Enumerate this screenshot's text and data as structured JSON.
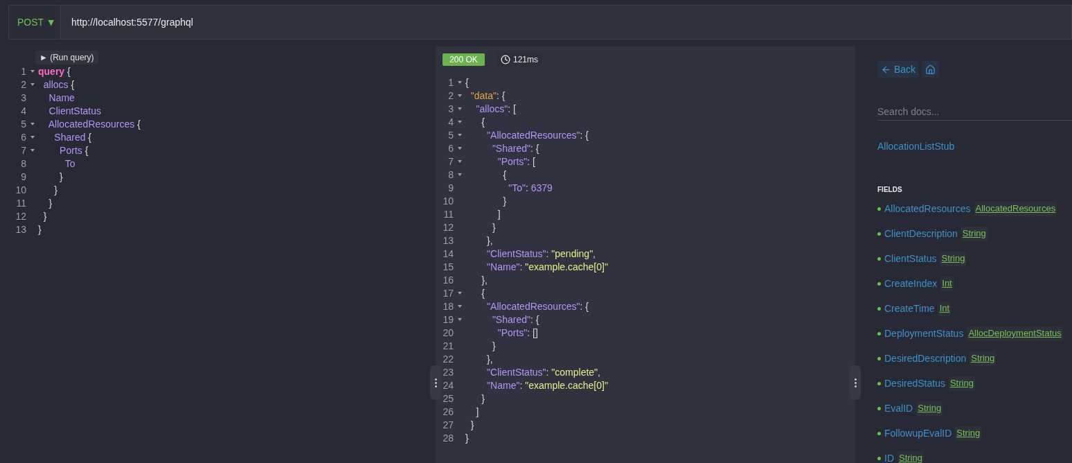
{
  "request": {
    "method": "POST ▼",
    "url": "http://localhost:5577/graphql"
  },
  "run_button": {
    "label": "► (Run query)"
  },
  "query_editor": {
    "lines": [
      {
        "number": "1",
        "foldable": true,
        "tokens": [
          {
            "kind": "keyword",
            "text": "query"
          },
          {
            "kind": "punct",
            "text": " {"
          }
        ]
      },
      {
        "number": "2",
        "foldable": true,
        "tokens": [
          {
            "kind": "field",
            "text": "  allocs"
          },
          {
            "kind": "punct",
            "text": " {"
          }
        ]
      },
      {
        "number": "3",
        "foldable": false,
        "tokens": [
          {
            "kind": "field",
            "text": "    Name"
          }
        ]
      },
      {
        "number": "4",
        "foldable": false,
        "tokens": [
          {
            "kind": "field",
            "text": "    ClientStatus"
          }
        ]
      },
      {
        "number": "5",
        "foldable": true,
        "tokens": [
          {
            "kind": "field",
            "text": "    AllocatedResources"
          },
          {
            "kind": "punct",
            "text": " {"
          }
        ]
      },
      {
        "number": "6",
        "foldable": true,
        "tokens": [
          {
            "kind": "field",
            "text": "      Shared"
          },
          {
            "kind": "punct",
            "text": " {"
          }
        ]
      },
      {
        "number": "7",
        "foldable": true,
        "tokens": [
          {
            "kind": "field",
            "text": "        Ports"
          },
          {
            "kind": "punct",
            "text": " {"
          }
        ]
      },
      {
        "number": "8",
        "foldable": false,
        "tokens": [
          {
            "kind": "field",
            "text": "          To"
          }
        ]
      },
      {
        "number": "9",
        "foldable": false,
        "tokens": [
          {
            "kind": "punct",
            "text": "        }"
          }
        ]
      },
      {
        "number": "10",
        "foldable": false,
        "tokens": [
          {
            "kind": "punct",
            "text": "      }"
          }
        ]
      },
      {
        "number": "11",
        "foldable": false,
        "tokens": [
          {
            "kind": "punct",
            "text": "    }"
          }
        ]
      },
      {
        "number": "12",
        "foldable": false,
        "tokens": [
          {
            "kind": "punct",
            "text": "  }"
          }
        ]
      },
      {
        "number": "13",
        "foldable": false,
        "tokens": [
          {
            "kind": "punct",
            "text": "}"
          }
        ]
      }
    ]
  },
  "response": {
    "status": "200 OK",
    "time": "121ms",
    "lines": [
      {
        "number": "1",
        "foldable": true,
        "tokens": [
          {
            "kind": "punct",
            "text": "{"
          }
        ]
      },
      {
        "number": "2",
        "foldable": true,
        "tokens": [
          {
            "kind": "data-key",
            "text": "  \"data\""
          },
          {
            "kind": "punct",
            "text": ": {"
          }
        ]
      },
      {
        "number": "3",
        "foldable": true,
        "tokens": [
          {
            "kind": "key",
            "text": "    \"allocs\""
          },
          {
            "kind": "punct",
            "text": ": ["
          }
        ]
      },
      {
        "number": "4",
        "foldable": true,
        "tokens": [
          {
            "kind": "punct",
            "text": "      {"
          }
        ]
      },
      {
        "number": "5",
        "foldable": true,
        "tokens": [
          {
            "kind": "key",
            "text": "        \"AllocatedResources\""
          },
          {
            "kind": "punct",
            "text": ": {"
          }
        ]
      },
      {
        "number": "6",
        "foldable": true,
        "tokens": [
          {
            "kind": "key",
            "text": "          \"Shared\""
          },
          {
            "kind": "punct",
            "text": ": {"
          }
        ]
      },
      {
        "number": "7",
        "foldable": true,
        "tokens": [
          {
            "kind": "key",
            "text": "            \"Ports\""
          },
          {
            "kind": "punct",
            "text": ": ["
          }
        ]
      },
      {
        "number": "8",
        "foldable": true,
        "tokens": [
          {
            "kind": "punct",
            "text": "              {"
          }
        ]
      },
      {
        "number": "9",
        "foldable": false,
        "tokens": [
          {
            "kind": "key",
            "text": "                \"To\""
          },
          {
            "kind": "punct",
            "text": ": "
          },
          {
            "kind": "number",
            "text": "6379"
          }
        ]
      },
      {
        "number": "10",
        "foldable": false,
        "tokens": [
          {
            "kind": "punct",
            "text": "              }"
          }
        ]
      },
      {
        "number": "11",
        "foldable": false,
        "tokens": [
          {
            "kind": "punct",
            "text": "            ]"
          }
        ]
      },
      {
        "number": "12",
        "foldable": false,
        "tokens": [
          {
            "kind": "punct",
            "text": "          }"
          }
        ]
      },
      {
        "number": "13",
        "foldable": false,
        "tokens": [
          {
            "kind": "punct",
            "text": "        },"
          }
        ]
      },
      {
        "number": "14",
        "foldable": false,
        "tokens": [
          {
            "kind": "key",
            "text": "        \"ClientStatus\""
          },
          {
            "kind": "punct",
            "text": ": "
          },
          {
            "kind": "string",
            "text": "\"pending\""
          },
          {
            "kind": "punct",
            "text": ","
          }
        ]
      },
      {
        "number": "15",
        "foldable": false,
        "tokens": [
          {
            "kind": "key",
            "text": "        \"Name\""
          },
          {
            "kind": "punct",
            "text": ": "
          },
          {
            "kind": "string",
            "text": "\"example.cache[0]\""
          }
        ]
      },
      {
        "number": "16",
        "foldable": false,
        "tokens": [
          {
            "kind": "punct",
            "text": "      },"
          }
        ]
      },
      {
        "number": "17",
        "foldable": true,
        "tokens": [
          {
            "kind": "punct",
            "text": "      {"
          }
        ]
      },
      {
        "number": "18",
        "foldable": true,
        "tokens": [
          {
            "kind": "key",
            "text": "        \"AllocatedResources\""
          },
          {
            "kind": "punct",
            "text": ": {"
          }
        ]
      },
      {
        "number": "19",
        "foldable": true,
        "tokens": [
          {
            "kind": "key",
            "text": "          \"Shared\""
          },
          {
            "kind": "punct",
            "text": ": {"
          }
        ]
      },
      {
        "number": "20",
        "foldable": false,
        "tokens": [
          {
            "kind": "key",
            "text": "            \"Ports\""
          },
          {
            "kind": "punct",
            "text": ": []"
          }
        ]
      },
      {
        "number": "21",
        "foldable": false,
        "tokens": [
          {
            "kind": "punct",
            "text": "          }"
          }
        ]
      },
      {
        "number": "22",
        "foldable": false,
        "tokens": [
          {
            "kind": "punct",
            "text": "        },"
          }
        ]
      },
      {
        "number": "23",
        "foldable": false,
        "tokens": [
          {
            "kind": "key",
            "text": "        \"ClientStatus\""
          },
          {
            "kind": "punct",
            "text": ": "
          },
          {
            "kind": "string",
            "text": "\"complete\""
          },
          {
            "kind": "punct",
            "text": ","
          }
        ]
      },
      {
        "number": "24",
        "foldable": false,
        "tokens": [
          {
            "kind": "key",
            "text": "        \"Name\""
          },
          {
            "kind": "punct",
            "text": ": "
          },
          {
            "kind": "string",
            "text": "\"example.cache[0]\""
          }
        ]
      },
      {
        "number": "25",
        "foldable": false,
        "tokens": [
          {
            "kind": "punct",
            "text": "      }"
          }
        ]
      },
      {
        "number": "26",
        "foldable": false,
        "tokens": [
          {
            "kind": "punct",
            "text": "    ]"
          }
        ]
      },
      {
        "number": "27",
        "foldable": false,
        "tokens": [
          {
            "kind": "punct",
            "text": "  }"
          }
        ]
      },
      {
        "number": "28",
        "foldable": false,
        "tokens": [
          {
            "kind": "punct",
            "text": "}"
          }
        ]
      }
    ]
  },
  "docs": {
    "back_label": "Back",
    "search": {
      "placeholder": "Search docs..."
    },
    "type_name": "AllocationListStub",
    "section": "FIELDS",
    "fields": [
      {
        "name": "AllocatedResources",
        "type": "AllocatedResources"
      },
      {
        "name": "ClientDescription",
        "type": "String"
      },
      {
        "name": "ClientStatus",
        "type": "String"
      },
      {
        "name": "CreateIndex",
        "type": "Int"
      },
      {
        "name": "CreateTime",
        "type": "Int"
      },
      {
        "name": "DeploymentStatus",
        "type": "AllocDeploymentStatus"
      },
      {
        "name": "DesiredDescription",
        "type": "String"
      },
      {
        "name": "DesiredStatus",
        "type": "String"
      },
      {
        "name": "EvalID",
        "type": "String"
      },
      {
        "name": "FollowupEvalID",
        "type": "String"
      },
      {
        "name": "ID",
        "type": "String"
      }
    ]
  }
}
